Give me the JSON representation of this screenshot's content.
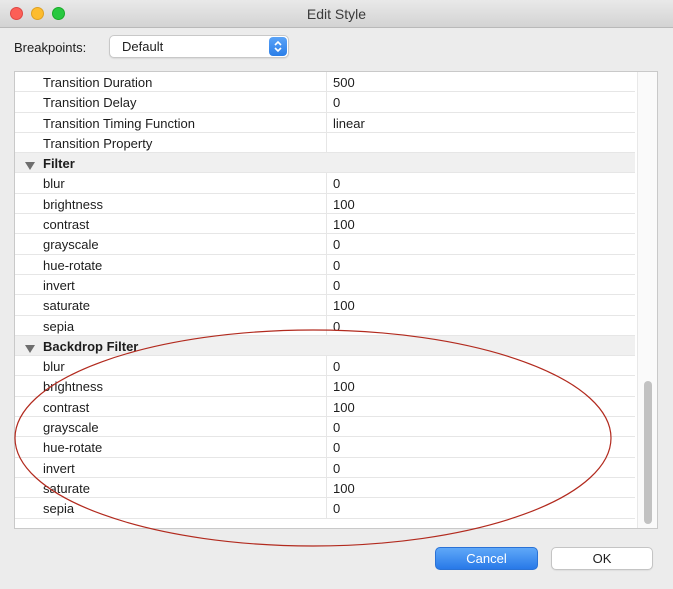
{
  "window": {
    "title": "Edit Style"
  },
  "breakpoints": {
    "label": "Breakpoints:",
    "value": "Default"
  },
  "rows": [
    {
      "type": "prop",
      "name": "Transition Duration",
      "value": "500"
    },
    {
      "type": "prop",
      "name": "Transition Delay",
      "value": "0"
    },
    {
      "type": "prop",
      "name": "Transition Timing Function",
      "value": "linear"
    },
    {
      "type": "prop",
      "name": "Transition Property",
      "value": ""
    },
    {
      "type": "group",
      "name": "Filter",
      "value": ""
    },
    {
      "type": "prop",
      "name": "blur",
      "value": "0"
    },
    {
      "type": "prop",
      "name": "brightness",
      "value": "100"
    },
    {
      "type": "prop",
      "name": "contrast",
      "value": "100"
    },
    {
      "type": "prop",
      "name": "grayscale",
      "value": "0"
    },
    {
      "type": "prop",
      "name": "hue-rotate",
      "value": "0"
    },
    {
      "type": "prop",
      "name": "invert",
      "value": "0"
    },
    {
      "type": "prop",
      "name": "saturate",
      "value": "100"
    },
    {
      "type": "prop",
      "name": "sepia",
      "value": "0"
    },
    {
      "type": "group",
      "name": "Backdrop Filter",
      "value": ""
    },
    {
      "type": "prop",
      "name": "blur",
      "value": "0"
    },
    {
      "type": "prop",
      "name": "brightness",
      "value": "100"
    },
    {
      "type": "prop",
      "name": "contrast",
      "value": "100"
    },
    {
      "type": "prop",
      "name": "grayscale",
      "value": "0"
    },
    {
      "type": "prop",
      "name": "hue-rotate",
      "value": "0"
    },
    {
      "type": "prop",
      "name": "invert",
      "value": "0"
    },
    {
      "type": "prop",
      "name": "saturate",
      "value": "100"
    },
    {
      "type": "prop",
      "name": "sepia",
      "value": "0"
    }
  ],
  "buttons": {
    "cancel": "Cancel",
    "ok": "OK"
  },
  "colors": {
    "accent": "#2a7ee8",
    "annotation": "#b22a1e",
    "group_bg": "#f0f0f0"
  },
  "icons": {
    "group_toggle": "disclosure-triangle-down-icon",
    "select": "up-down-chevron-icon"
  }
}
